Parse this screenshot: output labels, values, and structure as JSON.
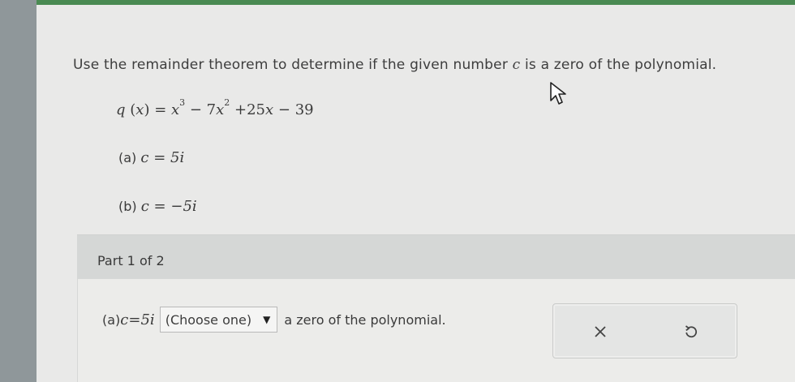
{
  "question": {
    "prefix": "Use the remainder theorem to determine if the given number ",
    "variable": "c",
    "suffix": " is a zero of the polynomial."
  },
  "polynomial": {
    "fn": "q",
    "arg": "x",
    "eq": " = ",
    "t1_base": "x",
    "t1_exp": "3",
    "t2_coef": " − 7",
    "t2_base": "x",
    "t2_exp": "2",
    "t3_coef": " +25",
    "t3_base": "x",
    "t4": " − 39"
  },
  "items": [
    {
      "label": "(a) ",
      "var": "c",
      "eq": " = ",
      "value": "5i"
    },
    {
      "label": "(b) ",
      "var": "c",
      "eq": " = ",
      "value": "−5i"
    }
  ],
  "part": {
    "label": "Part 1 of 2"
  },
  "answer": {
    "label": "(a) ",
    "var": "c",
    "eq": " = ",
    "value": "5i",
    "select_value": "(Choose one)",
    "after": "a zero of the polynomial."
  },
  "icons": {
    "cursor": "mouse-pointer-icon",
    "clear": "close-icon",
    "undo": "undo-icon"
  },
  "colors": {
    "top_bar": "#4a8a52",
    "page_bg": "#e9e9e8",
    "part_header_bg": "#d5d7d6"
  }
}
